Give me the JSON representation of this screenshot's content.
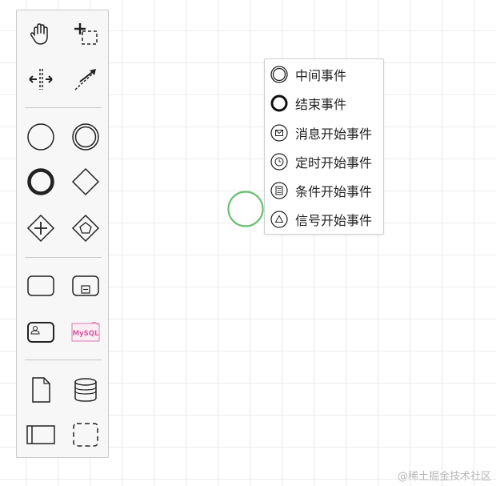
{
  "palette": {
    "tools": [
      {
        "icon": "hand-tool-icon"
      },
      {
        "icon": "lasso-tool-icon"
      },
      {
        "icon": "space-tool-icon"
      },
      {
        "icon": "global-connect-tool-icon"
      },
      {
        "icon": "start-event-icon"
      },
      {
        "icon": "intermediate-event-icon"
      },
      {
        "icon": "end-event-icon"
      },
      {
        "icon": "gateway-icon"
      },
      {
        "icon": "parallel-gateway-icon"
      },
      {
        "icon": "event-based-gateway-icon"
      },
      {
        "icon": "task-icon"
      },
      {
        "icon": "subprocess-icon"
      },
      {
        "icon": "user-task-icon"
      },
      {
        "icon": "mysql-task-icon"
      },
      {
        "icon": "data-object-icon"
      },
      {
        "icon": "data-store-icon"
      },
      {
        "icon": "pool-icon"
      },
      {
        "icon": "group-icon"
      }
    ],
    "mysql_icon_text": "MySQL"
  },
  "canvas": {
    "start_event_color": "#6cbf73"
  },
  "context_menu": {
    "items": [
      {
        "label": "中间事件",
        "icon": "intermediate-event-icon"
      },
      {
        "label": "结束事件",
        "icon": "end-event-icon"
      },
      {
        "label": "消息开始事件",
        "icon": "message-start-event-icon"
      },
      {
        "label": "定时开始事件",
        "icon": "timer-start-event-icon"
      },
      {
        "label": "条件开始事件",
        "icon": "conditional-start-event-icon"
      },
      {
        "label": "信号开始事件",
        "icon": "signal-start-event-icon"
      }
    ]
  },
  "watermark": "@稀土掘金技术社区"
}
